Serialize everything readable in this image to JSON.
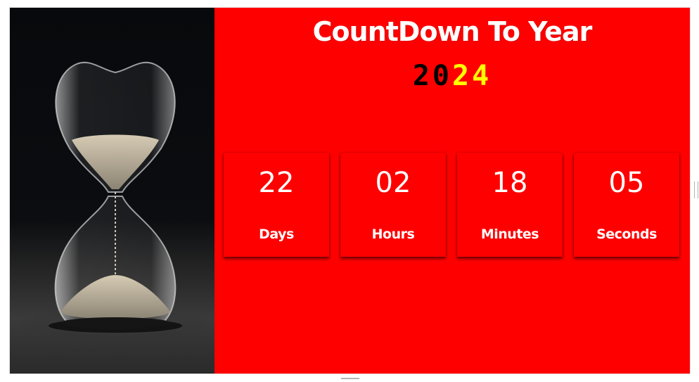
{
  "header": {
    "title": "CountDown To Year",
    "year_digits": [
      {
        "char": "2",
        "color": "#000000"
      },
      {
        "char": "0",
        "color": "#000000"
      },
      {
        "char": "2",
        "color": "#ffff00"
      },
      {
        "char": "4",
        "color": "#ffff00"
      }
    ]
  },
  "image": {
    "icon": "hourglass-icon"
  },
  "countdown": [
    {
      "value": "22",
      "label": "Days"
    },
    {
      "value": "02",
      "label": "Hours"
    },
    {
      "value": "18",
      "label": "Minutes"
    },
    {
      "value": "05",
      "label": "Seconds"
    }
  ],
  "colors": {
    "background": "#ff0000",
    "text": "#ffffff",
    "accent_dark": "#000000",
    "accent_light": "#ffff00"
  }
}
